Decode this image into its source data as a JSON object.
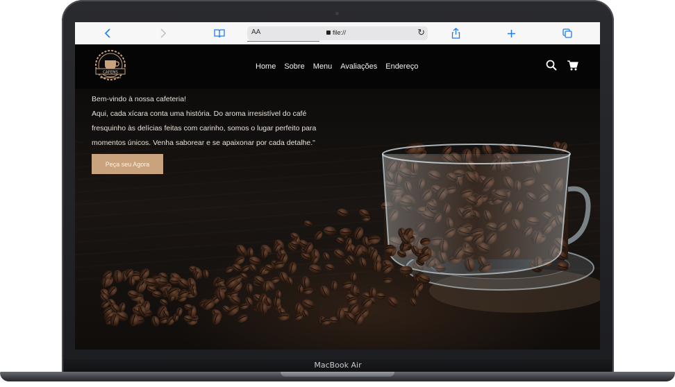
{
  "browser": {
    "aa_label": "AA",
    "url": "file://",
    "icons": [
      "back-icon",
      "forward-icon",
      "bookmarks-icon",
      "reload-icon",
      "share-icon",
      "new-tab-icon",
      "tabs-icon"
    ]
  },
  "site": {
    "logo_text": "CAFENS",
    "nav": [
      "Home",
      "Sobre",
      "Menu",
      "Avaliações",
      "Endereço"
    ],
    "hero_lines": [
      "Bem-vindo à nossa cafeteria!",
      "Aqui, cada xícara conta uma história. Do aroma irresistível do café",
      "fresquinho às delícias feitas com carinho, somos o lugar perfeito para",
      "momentos únicos. Venha saborear e se apaixonar por cada detalhe.\""
    ],
    "cta_label": "Peça seu Agora",
    "colors": {
      "accent": "#c9a27e",
      "nav_bg": "#050505",
      "text": "#e9e2da"
    }
  },
  "device": {
    "model_label": "MacBook Air"
  }
}
